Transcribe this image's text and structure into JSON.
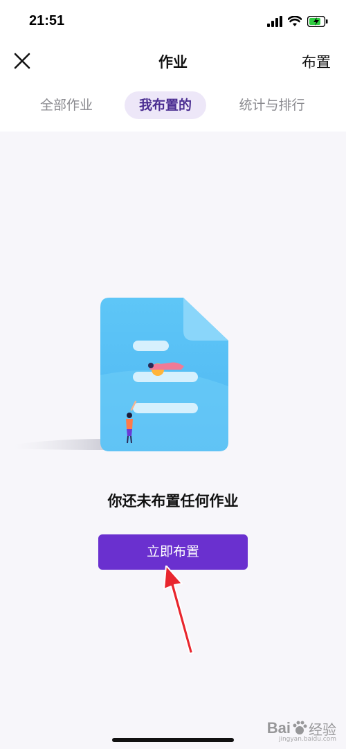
{
  "status_bar": {
    "time": "21:51"
  },
  "header": {
    "title": "作业",
    "action": "布置"
  },
  "tabs": [
    {
      "label": "全部作业",
      "active": false
    },
    {
      "label": "我布置的",
      "active": true
    },
    {
      "label": "统计与排行",
      "active": false
    }
  ],
  "empty_state": {
    "message": "你还未布置任何作业",
    "button_label": "立即布置"
  },
  "watermark": {
    "brand": "Bai",
    "brand_cn": "经验",
    "url": "jingyan.baidu.com"
  },
  "colors": {
    "accent": "#6a30cf",
    "tab_active_bg": "#ede7f8",
    "annotation_arrow": "#e8262e",
    "illustration": "#5cc4f6"
  }
}
